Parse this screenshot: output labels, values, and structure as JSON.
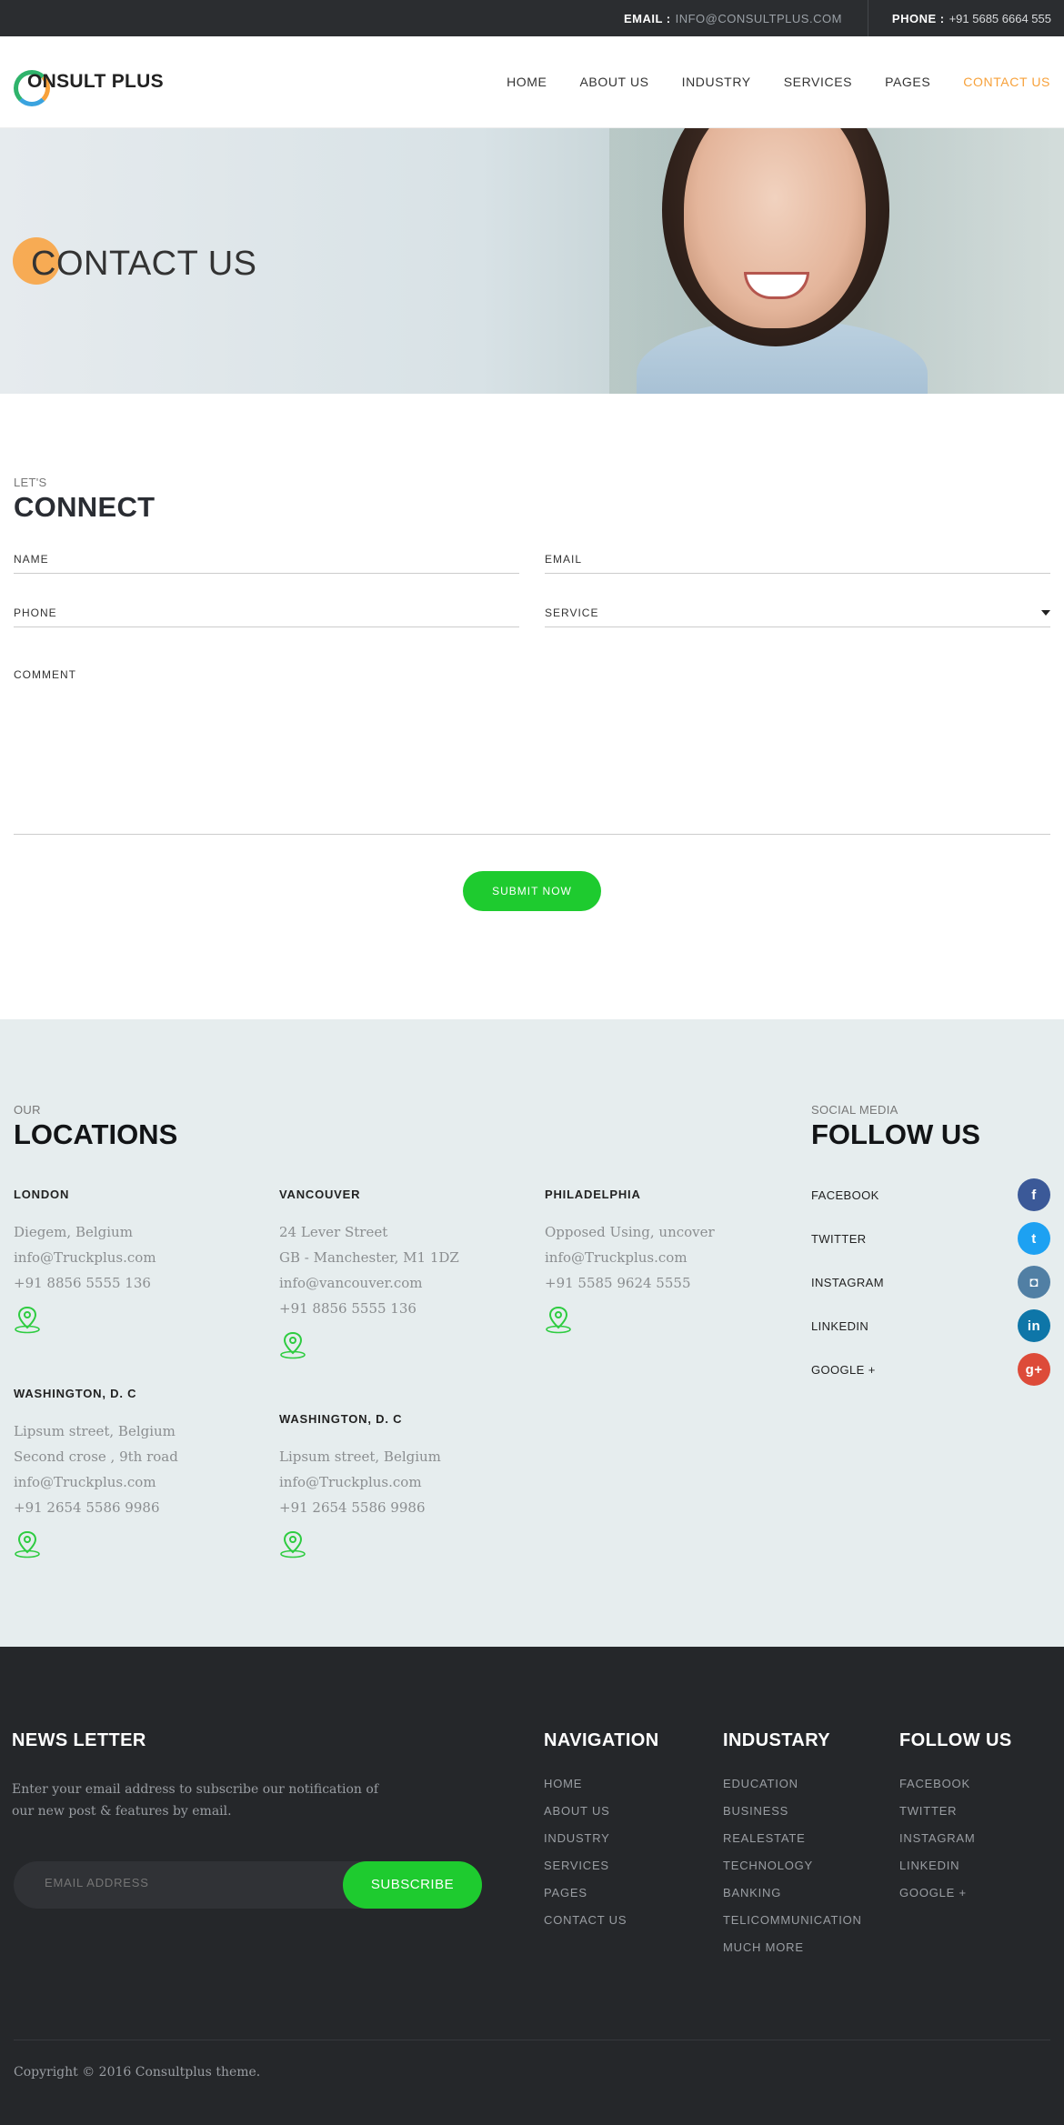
{
  "topbar": {
    "email_label": "EMAIL :",
    "email_value": "INFO@CONSULTPLUS.COM",
    "phone_label": "PHONE :",
    "phone_value": "+91 5685 6664 555"
  },
  "header": {
    "logo_text": "ONSULT PLUS",
    "nav": [
      "HOME",
      "ABOUT US",
      "INDUSTRY",
      "SERVICES",
      "PAGES",
      "CONTACT US"
    ],
    "active_color": "#f7a13a"
  },
  "banner": {
    "title": "CONTACT US"
  },
  "connect": {
    "eyebrow": "LET'S",
    "title": "CONNECT",
    "name_label": "NAME",
    "email_label": "EMAIL",
    "phone_label": "PHONE",
    "service_label": "SERVICE",
    "comment_label": "COMMENT",
    "submit_label": "SUBMIT NOW",
    "accent": "#1ecb2f"
  },
  "locations": {
    "eyebrow": "OUR",
    "title": "LOCATIONS",
    "items": [
      {
        "city": "LONDON",
        "lines": [
          "Diegem, Belgium",
          "info@Truckplus.com",
          "+91 8856 5555 136"
        ]
      },
      {
        "city": "VANCOUVER",
        "lines": [
          "24 Lever Street",
          "GB - Manchester, M1 1DZ",
          "info@vancouver.com",
          "+91 8856 5555 136"
        ]
      },
      {
        "city": "PHILADELPHIA",
        "lines": [
          "Opposed Using, uncover",
          "info@Truckplus.com",
          "+91 5585 9624  5555"
        ]
      },
      {
        "city": "WASHINGTON, D. C",
        "lines": [
          "Lipsum street, Belgium",
          "Second crose , 9th road",
          "info@Truckplus.com",
          "+91 2654 5586 9986"
        ]
      },
      {
        "city": "WASHINGTON, D. C",
        "lines": [
          "Lipsum street, Belgium",
          "info@Truckplus.com",
          "+91 2654 5586 9986"
        ]
      }
    ]
  },
  "follow": {
    "eyebrow": "SOCIAL MEDIA",
    "title": "FOLLOW US",
    "items": [
      {
        "label": "FACEBOOK",
        "glyph": "f",
        "color": "#3b5998",
        "icon": "facebook-icon"
      },
      {
        "label": "TWITTER",
        "glyph": "t",
        "color": "#1da1f2",
        "icon": "twitter-icon"
      },
      {
        "label": "INSTAGRAM",
        "glyph": "◘",
        "color": "#517fa4",
        "icon": "instagram-icon"
      },
      {
        "label": "LINKEDIN",
        "glyph": "in",
        "color": "#0e76a8",
        "icon": "linkedin-icon"
      },
      {
        "label": "GOOGLE +",
        "glyph": "g+",
        "color": "#dd4b39",
        "icon": "google-plus-icon"
      }
    ]
  },
  "footer": {
    "news_title": "NEWS LETTER",
    "news_text": "Enter your email address to subscribe our notification of our new post & features by email.",
    "email_placeholder": "EMAIL ADDRESS",
    "subscribe_label": "SUBSCRIBE",
    "nav_title": "NAVIGATION",
    "nav_items": [
      "HOME",
      "ABOUT US",
      "INDUSTRY",
      "SERVICES",
      "PAGES",
      "CONTACT US"
    ],
    "industry_title": "INDUSTARY",
    "industry_items": [
      "EDUCATION",
      "BUSINESS",
      "REALESTATE",
      "TECHNOLOGY",
      "BANKING",
      "TELICOMMUNICATION",
      "MUCH MORE"
    ],
    "follow_title": "FOLLOW US",
    "follow_items": [
      "FACEBOOK",
      "TWITTER",
      "INSTAGRAM",
      "LINKEDIN",
      "GOOGLE +"
    ],
    "copyright": "Copyright © 2016 Consultplus theme."
  }
}
